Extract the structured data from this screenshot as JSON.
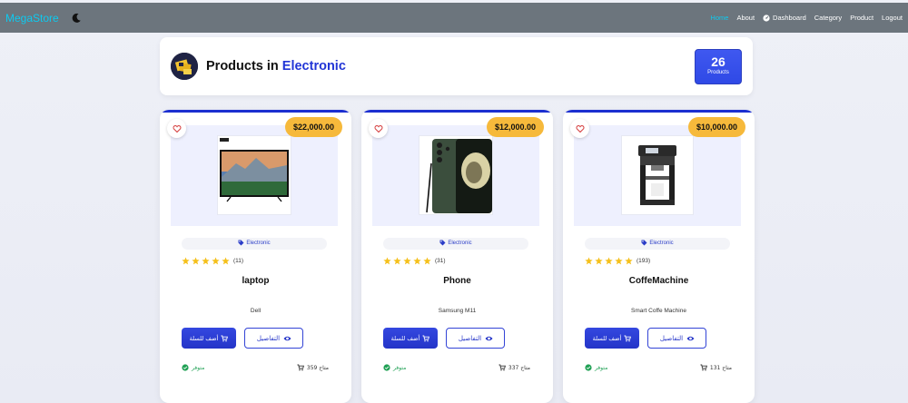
{
  "navbar": {
    "brand": "MegaStore",
    "links": [
      "Home",
      "About",
      "Dashboard",
      "Category",
      "Product",
      "Logout"
    ]
  },
  "header": {
    "title_prefix": "Products in",
    "category": "Electronic",
    "count": "26",
    "count_label": "Products"
  },
  "products": [
    {
      "price": "$22,000.00",
      "category": "Electronic",
      "rating": 5,
      "reviews": "(11)",
      "name": "laptop",
      "description": "Dell",
      "add_label": "أضف للسلة",
      "details_label": "التفاصيل",
      "availability": "متوفر",
      "stock": "متاح 359"
    },
    {
      "price": "$12,000.00",
      "category": "Electronic",
      "rating": 5,
      "reviews": "(31)",
      "name": "Phone",
      "description": "Samsung M11",
      "add_label": "أضف للسلة",
      "details_label": "التفاصيل",
      "availability": "متوفر",
      "stock": "متاح 337"
    },
    {
      "price": "$10,000.00",
      "category": "Electronic",
      "rating": 5,
      "reviews": "(193)",
      "name": "CoffeMachine",
      "description": "Smart Coffe Machine",
      "add_label": "أضف للسلة",
      "details_label": "التفاصيل",
      "availability": "متوفر",
      "stock": "متاح 131"
    }
  ],
  "colors": {
    "accent": "#2135d6",
    "price_badge": "#f6b93b",
    "brand": "#0dcaf0",
    "navbar": "#6c757d",
    "available": "#21a155"
  }
}
